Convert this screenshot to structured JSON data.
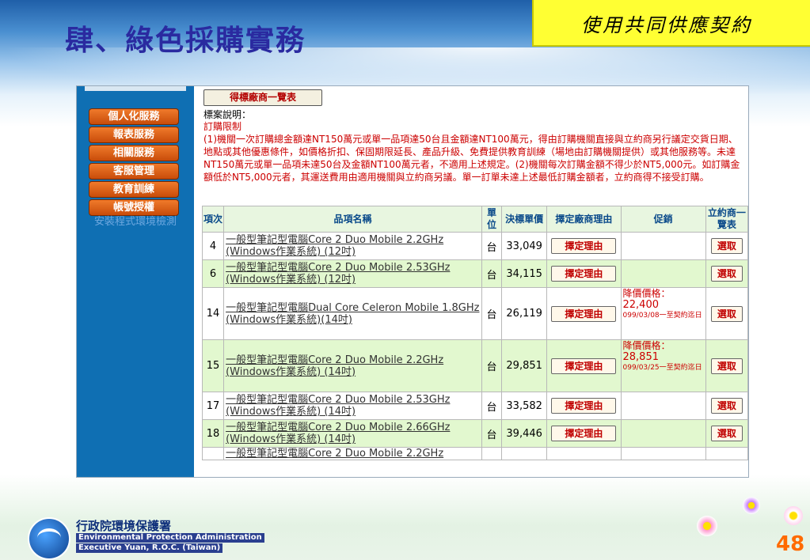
{
  "slide": {
    "title": "肆、綠色採購實務",
    "badge": "使用共同供應契約",
    "page_number": "48"
  },
  "sidebar": {
    "items": [
      {
        "label": "個人化服務"
      },
      {
        "label": "報表服務"
      },
      {
        "label": "相關服務"
      },
      {
        "label": "客服管理"
      },
      {
        "label": "教育訓練"
      },
      {
        "label": "帳號授權"
      }
    ],
    "link": "安裝程式環境檢測"
  },
  "content": {
    "vendor_button": "得標廠商一覽表",
    "desc_label": "標案說明：",
    "desc_heading": "訂購限制",
    "desc_text": "(1)機關一次訂購總金額達NT150萬元或單一品項達50台且金額達NT100萬元，得由訂購機關直接與立約商另行議定交貨日期、地點或其他優惠條件，如價格折扣、保固期限延長、產品升級、免費提供教育訓練（場地由訂購機關提供）或其他服務等。未達NT150萬元或單一品項未達50台及金額NT100萬元者，不適用上述規定。(2)機關每次訂購金額不得少於NT5,000元。如訂購金額低於NT5,000元者，其運送費用由適用機關與立約商另議。單一訂單未達上述最低訂購金額者，立約商得不接受訂購。"
  },
  "table": {
    "headers": [
      "項次",
      "品項名稱",
      "單位",
      "決標單價",
      "擇定廠商理由",
      "促銷",
      "立約商一覽表"
    ],
    "reason_label": "擇定理由",
    "pick_label": "選取",
    "rows": [
      {
        "no": "4",
        "name": "一般型筆記型電腦Core 2 Duo Mobile 2.2GHz (Windows作業系統) (12吋)",
        "unit": "台",
        "price": "33,049",
        "promo_label": "",
        "promo_price": "",
        "promo_date": ""
      },
      {
        "no": "6",
        "name": "一般型筆記型電腦Core 2 Duo Mobile 2.53GHz (Windows作業系統) (12吋)",
        "unit": "台",
        "price": "34,115",
        "promo_label": "",
        "promo_price": "",
        "promo_date": ""
      },
      {
        "no": "14",
        "name": "一般型筆記型電腦Dual Core Celeron Mobile 1.8GHz (Windows作業系統)(14吋)",
        "unit": "台",
        "price": "26,119",
        "promo_label": "降價價格：",
        "promo_price": "22,400",
        "promo_date": "099/03/08一至契約迄日"
      },
      {
        "no": "15",
        "name": "一般型筆記型電腦Core 2 Duo Mobile 2.2GHz (Windows作業系統) (14吋)",
        "unit": "台",
        "price": "29,851",
        "promo_label": "降價價格：",
        "promo_price": "28,851",
        "promo_date": "099/03/25一至契約迄日"
      },
      {
        "no": "17",
        "name": "一般型筆記型電腦Core 2 Duo Mobile 2.53GHz (Windows作業系統) (14吋)",
        "unit": "台",
        "price": "33,582",
        "promo_label": "",
        "promo_price": "",
        "promo_date": ""
      },
      {
        "no": "18",
        "name": "一般型筆記型電腦Core 2 Duo Mobile 2.66GHz (Windows作業系統) (14吋)",
        "unit": "台",
        "price": "39,446",
        "promo_label": "",
        "promo_price": "",
        "promo_date": ""
      },
      {
        "no": "",
        "name": "一般型筆記型電腦Core 2 Duo Mobile 2.2GHz",
        "unit": "",
        "price": "",
        "promo_label": "",
        "promo_price": "",
        "promo_date": ""
      }
    ]
  },
  "footer": {
    "org_cn": "行政院環境保護署",
    "org_en_1": "Environmental Protection Administration",
    "org_en_2": "Executive Yuan, R.O.C. (Taiwan)"
  },
  "colors": {
    "title": "#2a2aa0",
    "badge_bg": "#ffff33",
    "sidebar_bg": "#0f6fb3",
    "sidebar_button": "#e0621a",
    "desc_text": "#cc0000",
    "row_alt": "#e2f8cf",
    "highlight_circle": "#e00000"
  },
  "icons": [
    "epa-logo-icon",
    "flower-icon"
  ]
}
